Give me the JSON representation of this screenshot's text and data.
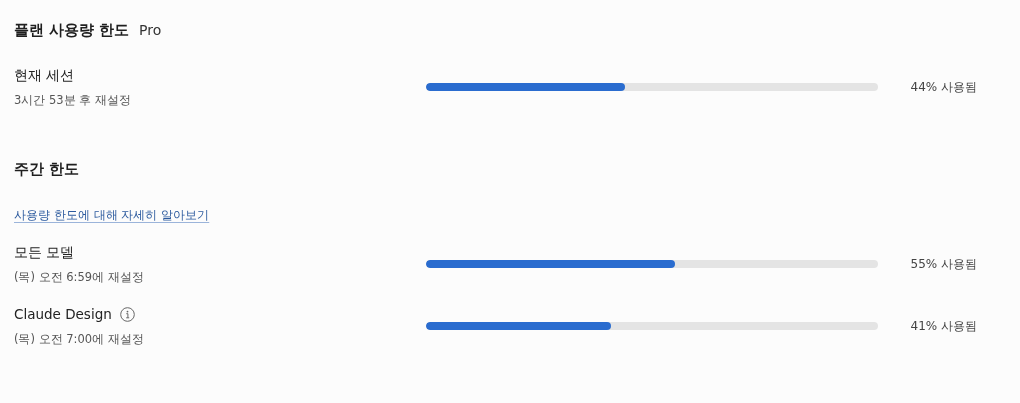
{
  "plan": {
    "title": "플랜 사용량 한도",
    "badge": "Pro"
  },
  "current_session": {
    "meters": [
      {
        "name": "현재 세션",
        "reset": "3시간 53분 후 재설정",
        "level": 0.44,
        "reading": "44% 사용됨",
        "has_info": false
      }
    ]
  },
  "weekly": {
    "title": "주간 한도",
    "link": "사용량 한도에 대해 자세히 알아보기",
    "meters": [
      {
        "name": "모든 모델",
        "reset": "(목) 오전 6:59에 재설정",
        "level": 0.55,
        "reading": "55% 사용됨",
        "has_info": false
      },
      {
        "name": "Claude Design",
        "reset": "(목) 오전 7:00에 재설정",
        "level": 0.41,
        "reading": "41% 사용됨",
        "has_info": true
      }
    ]
  }
}
